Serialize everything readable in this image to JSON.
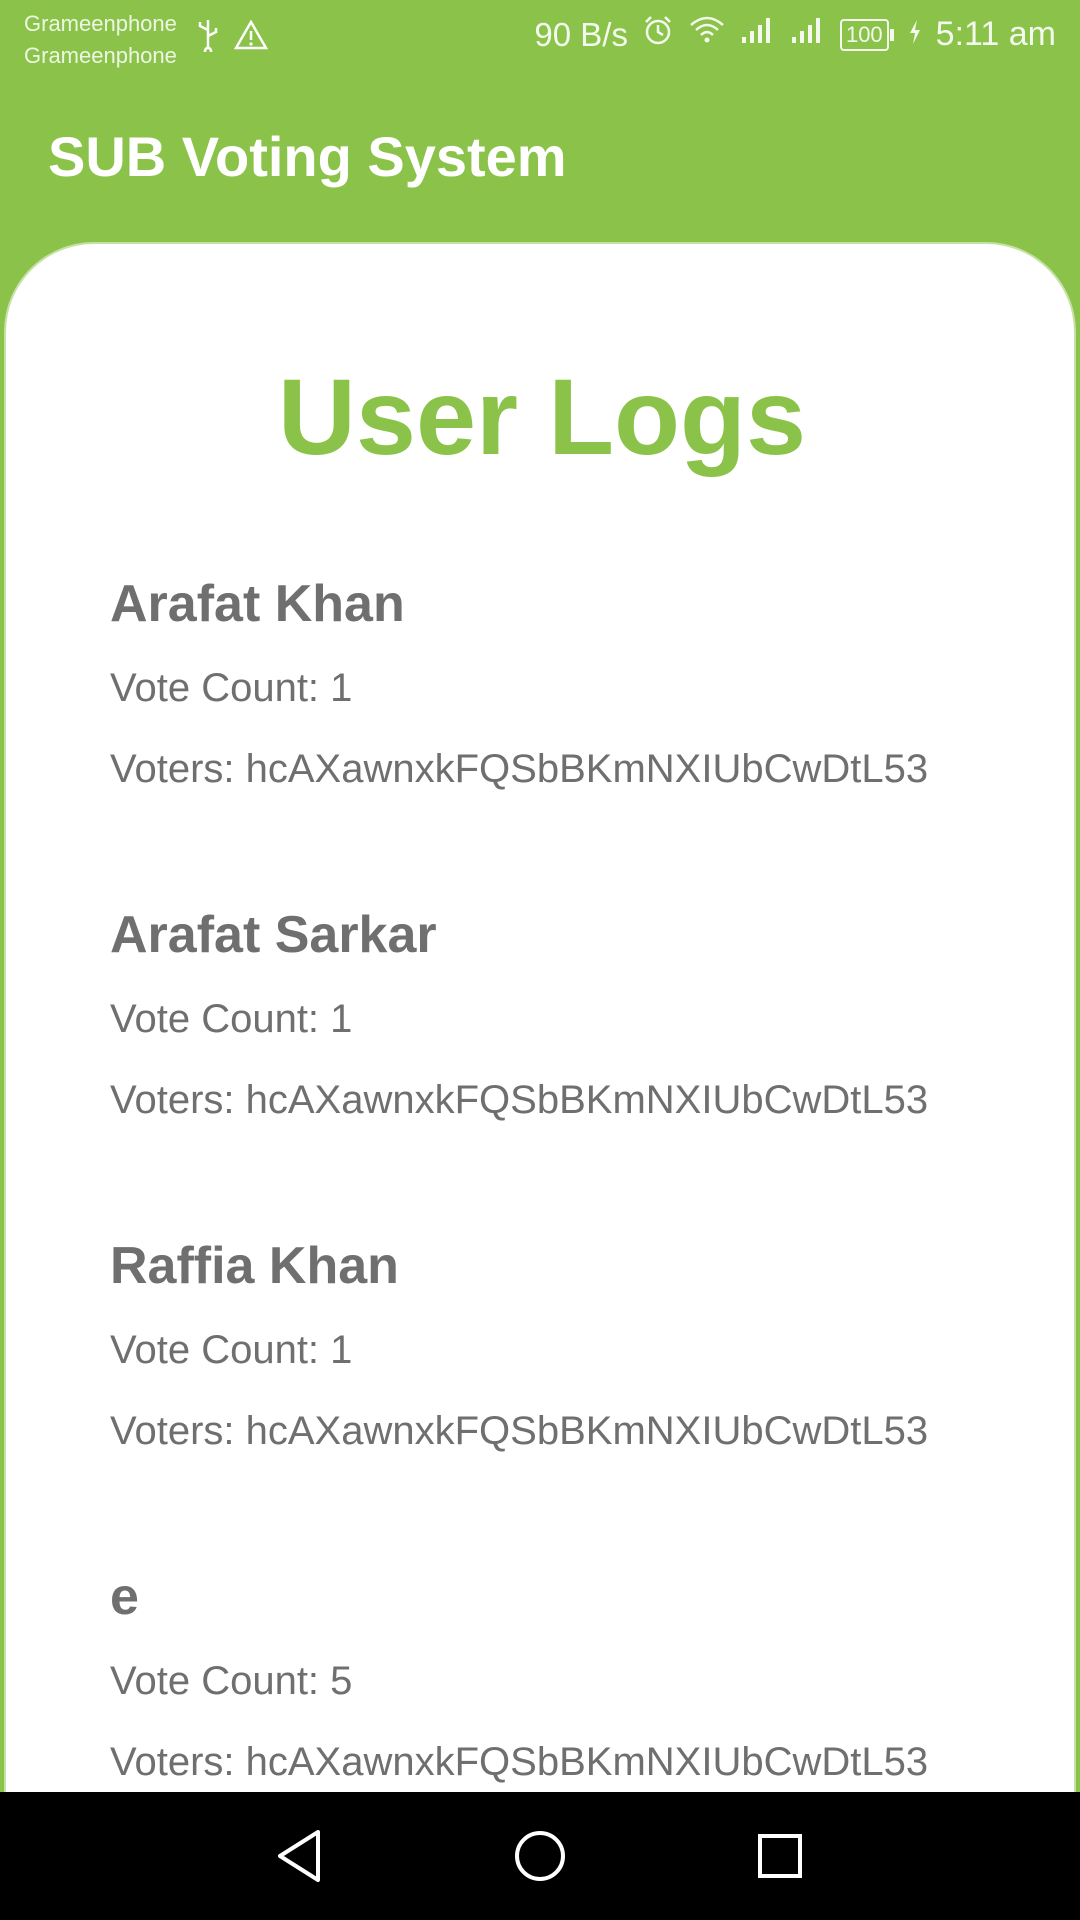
{
  "status_bar": {
    "carrier_1": "Grameenphone",
    "carrier_2": "Grameenphone",
    "net_speed": "90 B/s",
    "battery": "100",
    "time": "5:11 am",
    "icons": [
      "usb-icon",
      "warning-icon",
      "alarm-icon",
      "wifi-icon",
      "signal-icon",
      "signal-icon",
      "battery-icon",
      "charging-icon"
    ]
  },
  "app_bar": {
    "title": "SUB Voting System"
  },
  "page": {
    "title": "User Logs"
  },
  "logs": [
    {
      "name": "Arafat Khan",
      "vote_count": "Vote Count: 1",
      "voters": "Voters: hcAXawnxkFQSbBKmNXIUbCwDtL53"
    },
    {
      "name": "Arafat Sarkar",
      "vote_count": "Vote Count: 1",
      "voters": "Voters: hcAXawnxkFQSbBKmNXIUbCwDtL53"
    },
    {
      "name": "Raffia Khan",
      "vote_count": "Vote Count: 1",
      "voters": "Voters: hcAXawnxkFQSbBKmNXIUbCwDtL53"
    },
    {
      "name": "e",
      "vote_count": "Vote Count: 5",
      "voters": "Voters: hcAXawnxkFQSbBKmNXIUbCwDtL53"
    }
  ],
  "colors": {
    "brand_green": "#8BC34A",
    "text_gray": "#6f6f6f",
    "card_background": "#ffffff",
    "nav_background": "#000000"
  },
  "nav_bar": {
    "icons": [
      "back-icon",
      "home-icon",
      "recent-apps-icon"
    ]
  }
}
